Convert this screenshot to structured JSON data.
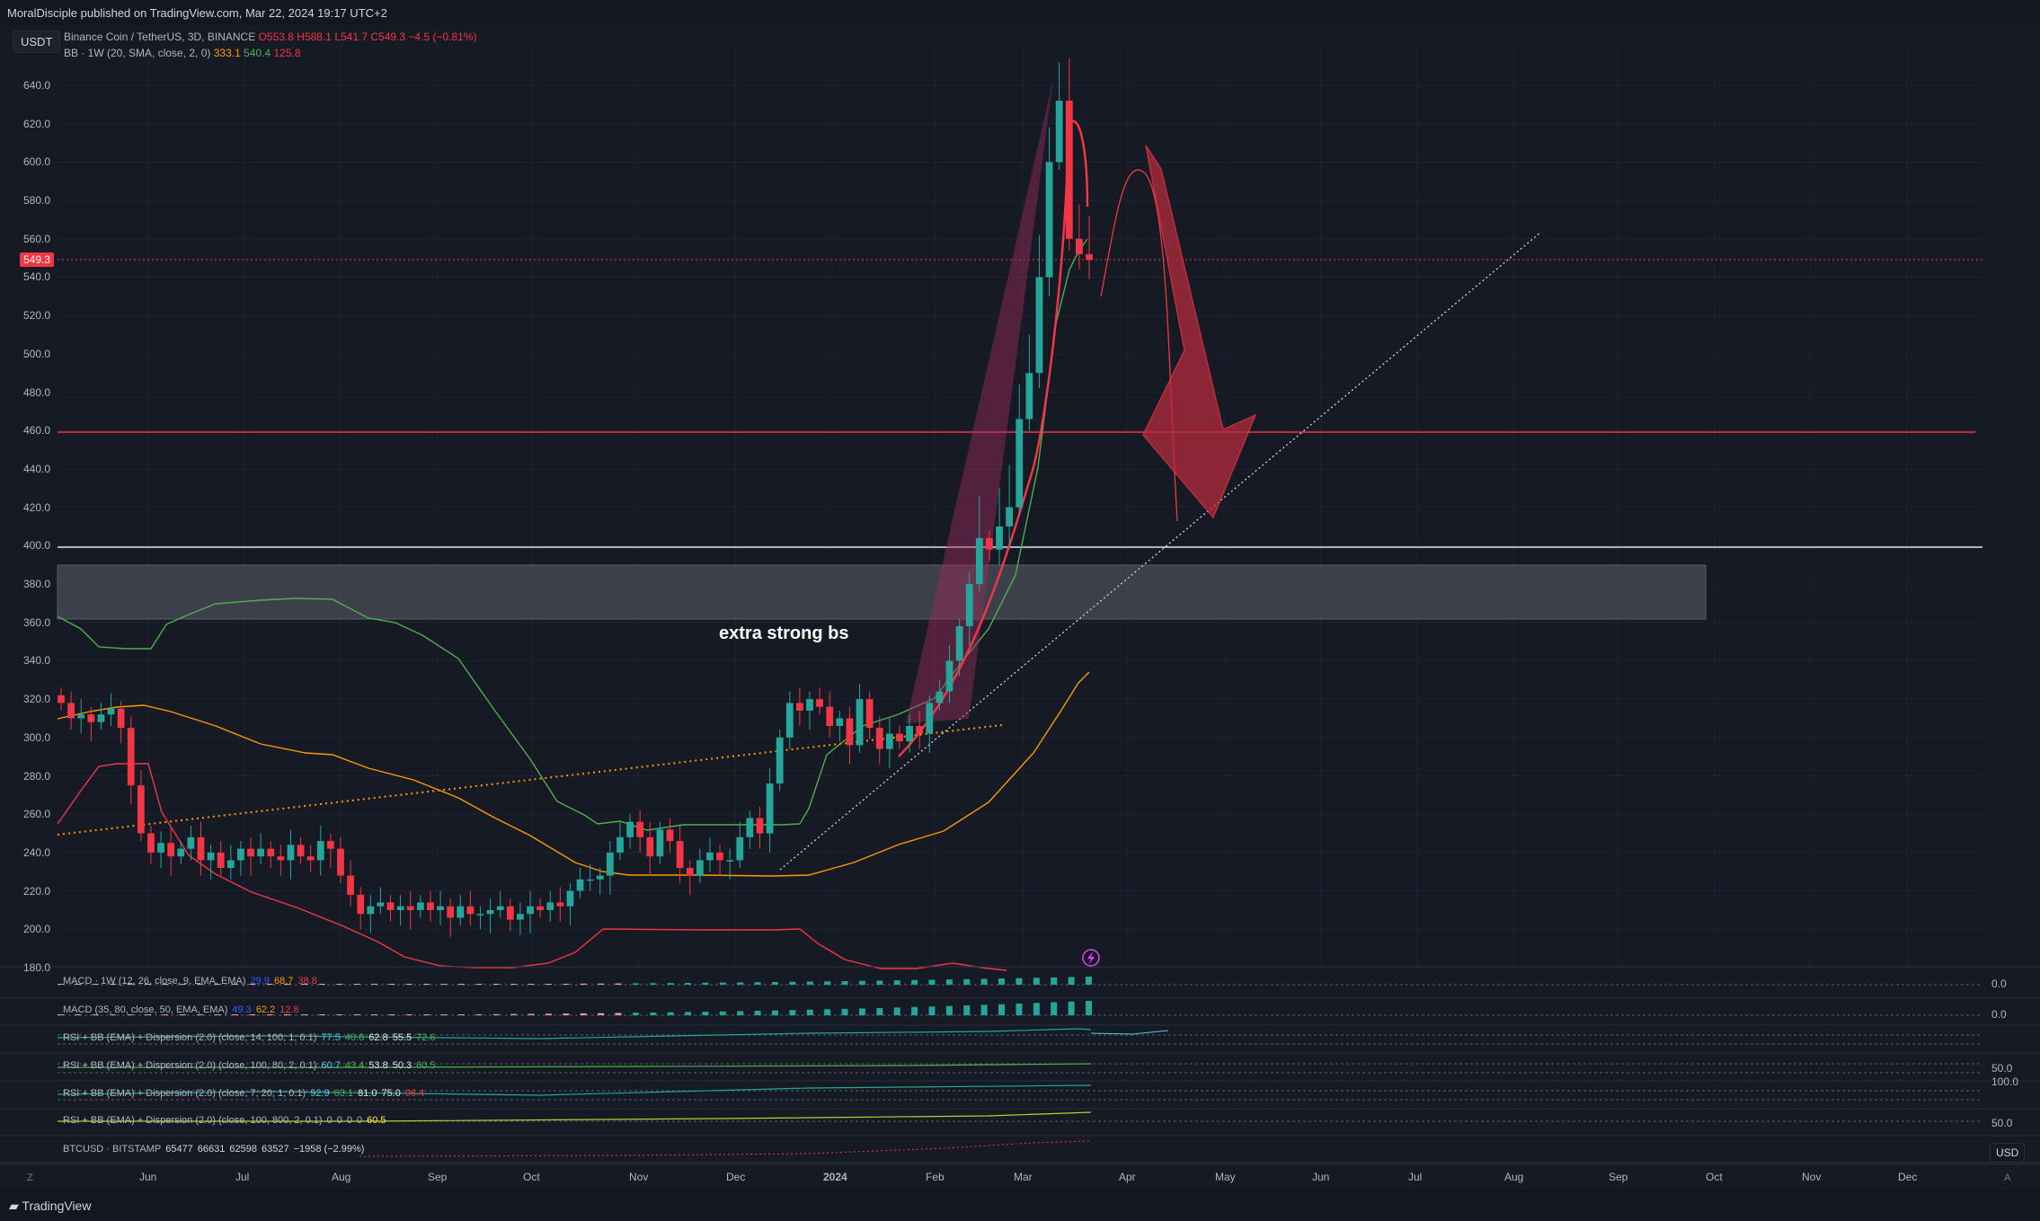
{
  "header": {
    "published": "MoralDisciple published on TradingView.com, Mar 22, 2024 19:17 UTC+2"
  },
  "currency_badge": "USDT",
  "symbol_line": {
    "name": "Binance Coin / TetherUS, 3D, BINANCE",
    "open": "O553.8",
    "high": "H588.1",
    "low": "L541.7",
    "close": "C549.3",
    "change": "−4.5 (−0.81%)"
  },
  "bb_line": {
    "name": "BB · 1W (20, SMA, close, 2, 0)",
    "v1": "333.1",
    "v2": "540.4",
    "v3": "125.8"
  },
  "price_axis": [
    "640.0",
    "620.0",
    "600.0",
    "580.0",
    "560.0",
    "540.0",
    "520.0",
    "500.0",
    "480.0",
    "460.0",
    "440.0",
    "420.0",
    "400.0",
    "380.0",
    "360.0",
    "340.0",
    "320.0",
    "300.0",
    "280.0",
    "260.0",
    "240.0",
    "220.0",
    "200.0",
    "180.0"
  ],
  "last_price": "549.3",
  "annotation": "extra strong bs",
  "indicators": [
    {
      "label": "MACD · 1W (12, 26, close, 9, EMA, EMA)",
      "values": [
        "29.9",
        "68.7",
        "38.8"
      ],
      "right": "0.0"
    },
    {
      "label": "MACD (35, 80, close, 50, EMA, EMA)",
      "values": [
        "49.3",
        "62.2",
        "12.8"
      ],
      "right": "0.0"
    },
    {
      "label": "RSI + BB (EMA) + Dispersion (2.0) (close, 14, 100, 1, 0.1)",
      "values": [
        "77.5",
        "40.8",
        "62.8",
        "55.5",
        "72.6"
      ],
      "right": ""
    },
    {
      "label": "RSI + BB (EMA) + Dispersion (2.0) (close, 100, 80, 2, 0.1)",
      "values": [
        "60.7",
        "43.4",
        "53.8",
        "50.3",
        "60.5"
      ],
      "right": "50.0"
    },
    {
      "label": "RSI + BB (EMA) + Dispersion (2.0) (close, 7, 20, 1, 0.1)",
      "values": [
        "92.9",
        "63.1",
        "81.0",
        "75.0",
        "96.4"
      ],
      "right": "100.0"
    },
    {
      "label": "RSI + BB (EMA) + Dispersion (2.0) (close, 100, 800, 2, 0.1)",
      "values": [
        "0",
        "0",
        "0",
        "0",
        "60.5"
      ],
      "right": "50.0"
    },
    {
      "label": "BTCUSD · BITSTAMP",
      "values": [
        "65477",
        "66631",
        "62598",
        "63527",
        "−1958 (−2.99%)"
      ],
      "right": "USD"
    }
  ],
  "time_axis": [
    "Jun",
    "Jul",
    "Aug",
    "Sep",
    "Oct",
    "Nov",
    "Dec",
    "2024",
    "Feb",
    "Mar",
    "Apr",
    "May",
    "Jun",
    "Jul",
    "Aug",
    "Sep",
    "Oct",
    "Nov",
    "Dec"
  ],
  "footer": {
    "logo": "TradingView"
  },
  "colors": {
    "bg": "#161a25",
    "up": "#26a69a",
    "down": "#f23645",
    "bb_upper": "#4caf50",
    "bb_basis": "#ff9800",
    "bb_lower": "#f23645",
    "zone": "#787b86",
    "drawing": "#f23645"
  }
}
